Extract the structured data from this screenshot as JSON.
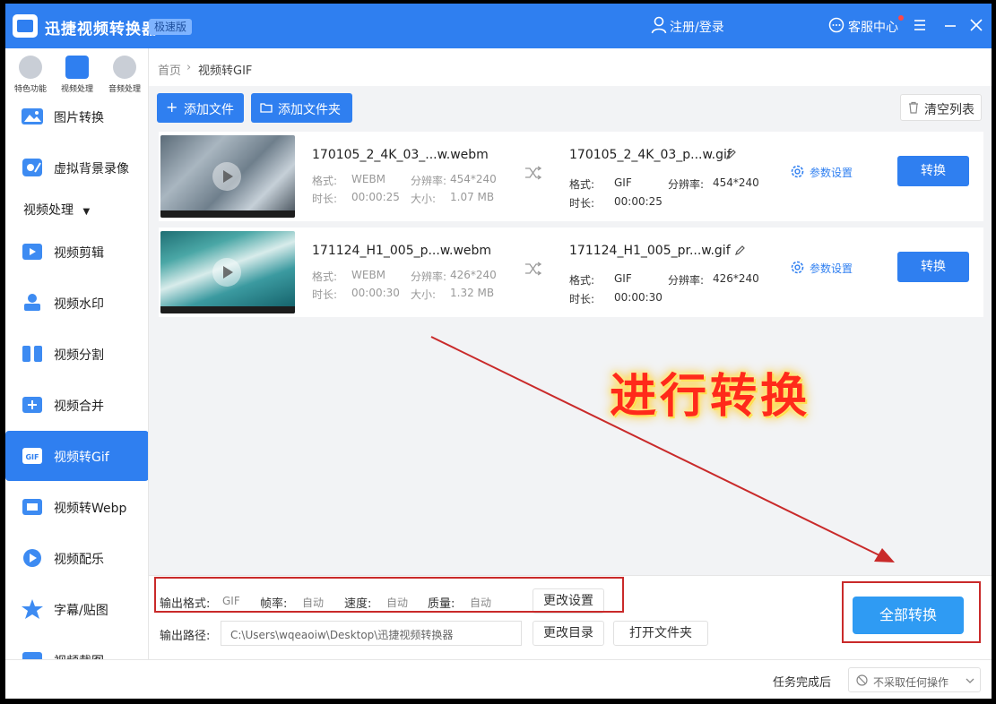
{
  "app": {
    "title": "迅捷视频转换器",
    "edition": "极速版",
    "login": "注册/登录",
    "support": "客服中心"
  },
  "colors": {
    "primary": "#2f7ff0",
    "annotation": "#c92a2a"
  },
  "top_tabs": [
    {
      "label": "特色功能",
      "icon": "star-icon"
    },
    {
      "label": "视频处理",
      "icon": "film-icon"
    },
    {
      "label": "音频处理",
      "icon": "music-icon"
    }
  ],
  "sidebar": {
    "items_above": [
      {
        "label": "图片转换",
        "icon": "image-icon"
      },
      {
        "label": "虚拟背景录像",
        "icon": "camera-icon"
      }
    ],
    "section": "视频处理",
    "items": [
      {
        "label": "视频剪辑",
        "icon": "scissors-icon"
      },
      {
        "label": "视频水印",
        "icon": "stamp-icon"
      },
      {
        "label": "视频分割",
        "icon": "split-icon"
      },
      {
        "label": "视频合并",
        "icon": "merge-icon"
      },
      {
        "label": "视频转Gif",
        "icon": "gif-icon",
        "active": true
      },
      {
        "label": "视频转Webp",
        "icon": "webp-icon"
      },
      {
        "label": "视频配乐",
        "icon": "music-note-icon"
      },
      {
        "label": "字幕/贴图",
        "icon": "sticker-icon"
      },
      {
        "label": "视频截图",
        "icon": "screenshot-icon"
      }
    ]
  },
  "breadcrumb": {
    "home": "首页",
    "separator": "›",
    "current": "视频转GIF"
  },
  "toolbar": {
    "add_file": "添加文件",
    "add_folder": "添加文件夹",
    "clear_list": "清空列表"
  },
  "labels": {
    "format": "格式:",
    "resolution": "分辨率:",
    "duration": "时长:",
    "size": "大小:",
    "settings": "参数设置",
    "convert": "转换"
  },
  "files": [
    {
      "src_name": "170105_2_4K_03_...w.webm",
      "src_format": "WEBM",
      "src_resolution": "454*240",
      "src_duration": "00:00:25",
      "src_size": "1.07 MB",
      "dst_name": "170105_2_4K_03_p...w.gif",
      "dst_format": "GIF",
      "dst_resolution": "454*240",
      "dst_duration": "00:00:25"
    },
    {
      "src_name": "171124_H1_005_p...w.webm",
      "src_format": "WEBM",
      "src_resolution": "426*240",
      "src_duration": "00:00:30",
      "src_size": "1.32 MB",
      "dst_name": "171124_H1_005_pr...w.gif",
      "dst_format": "GIF",
      "dst_resolution": "426*240",
      "dst_duration": "00:00:30"
    }
  ],
  "output": {
    "format_label": "输出格式:",
    "format_value": "GIF",
    "fps_label": "帧率:",
    "fps_value": "自动",
    "speed_label": "速度:",
    "speed_value": "自动",
    "quality_label": "质量:",
    "quality_value": "自动",
    "change_settings": "更改设置",
    "path_label": "输出路径:",
    "path_value": "C:\\Users\\wqeaoiw\\Desktop\\迅捷视频转换器",
    "change_dir": "更改目录",
    "open_folder": "打开文件夹",
    "convert_all": "全部转换"
  },
  "status": {
    "label": "任务完成后",
    "option": "不采取任何操作"
  },
  "annotation": {
    "text": "进行转换"
  }
}
